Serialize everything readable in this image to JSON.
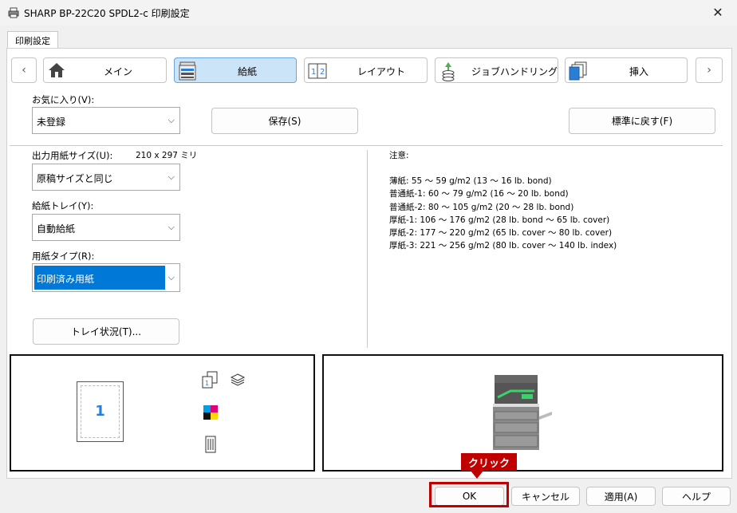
{
  "window": {
    "title": "SHARP BP-22C20 SPDL2-c 印刷設定",
    "close_symbol": "✕"
  },
  "tab": {
    "label": "印刷設定"
  },
  "nav": {
    "prev_symbol": "‹",
    "next_symbol": "›",
    "items": [
      {
        "label": "メイン",
        "icon": "home-icon"
      },
      {
        "label": "給紙",
        "icon": "paper-tray-icon",
        "active": true
      },
      {
        "label": "レイアウト",
        "icon": "layout-icon"
      },
      {
        "label": "ジョブハンドリング",
        "icon": "job-handling-icon"
      },
      {
        "label": "挿入",
        "icon": "insert-icon"
      }
    ]
  },
  "favorites": {
    "label": "お気に入り(V):",
    "value": "未登録",
    "save_label": "保存(S)",
    "reset_label": "標準に戻す(F)"
  },
  "output_size": {
    "label": "出力用紙サイズ(U):",
    "dimensions": "210 x 297 ミリ",
    "value": "原稿サイズと同じ"
  },
  "tray": {
    "label": "給紙トレイ(Y):",
    "value": "自動給紙"
  },
  "paper_type": {
    "label": "用紙タイプ(R):",
    "value": "印刷済み用紙"
  },
  "tray_status_label": "トレイ状況(T)...",
  "notes": {
    "heading": "注意:",
    "lines": [
      "薄紙: 55 〜 59 g/m2 (13 〜 16 lb. bond)",
      "普通紙-1: 60 〜 79 g/m2 (16 〜 20 lb. bond)",
      "普通紙-2: 80 〜 105 g/m2 (20 〜 28 lb. bond)",
      "厚紙-1: 106 〜 176 g/m2 (28 lb. bond 〜 65 lb. cover)",
      "厚紙-2: 177 〜 220 g/m2 (65 lb. cover 〜 80 lb. cover)",
      "厚紙-3: 221 〜 256 g/m2 (80 lb. cover 〜 140 lb. index)"
    ]
  },
  "preview": {
    "page_number": "1"
  },
  "bottom": {
    "ok": "OK",
    "cancel": "キャンセル",
    "apply": "適用(A)",
    "help": "ヘルプ"
  },
  "callout": {
    "text": "クリック"
  },
  "colors": {
    "accent": "#0078d7",
    "highlight": "#c00000",
    "active_tab": "#cce4f7"
  }
}
